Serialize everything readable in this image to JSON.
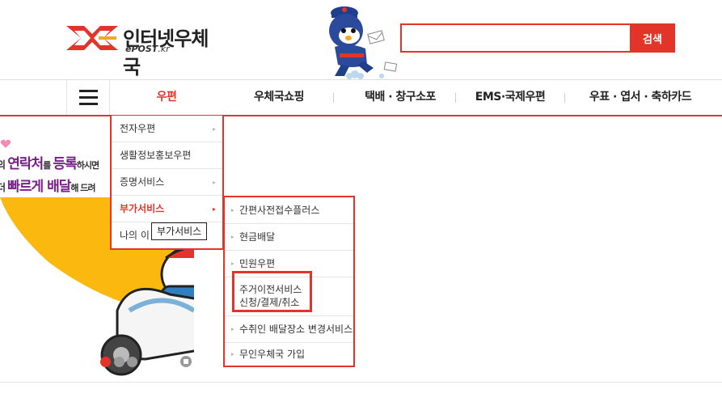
{
  "header": {
    "logo_text": "인터넷우체국",
    "logo_sub_bold": "ePOST",
    "logo_sub_rest": ".kr",
    "search": {
      "value": "",
      "placeholder": "",
      "button": "검색"
    }
  },
  "gnb": {
    "items": [
      {
        "label": "우편",
        "active": true
      },
      {
        "label": "우체국쇼핑"
      },
      {
        "label": "택배 · 창구소포"
      },
      {
        "label": "EMS·국제우편"
      },
      {
        "label": "우표 · 엽서 · 축하카드"
      }
    ]
  },
  "banner": {
    "line1_pre": "의",
    "line1_em": "연락처",
    "line1_mid": "를",
    "line1_em2": "등록",
    "line1_post": "하시면",
    "line2_pre": "더",
    "line2_em": "빠르게 배달",
    "line2_post": "해 드려",
    "colors": {
      "yellow": "#fbb90f",
      "red": "#e3342a",
      "purple": "#7a1f8a"
    }
  },
  "menu1": {
    "items": [
      {
        "label": "전자우편"
      },
      {
        "label": "생활정보홍보우편"
      },
      {
        "label": "증명서비스"
      },
      {
        "label": "부가서비스",
        "active": true
      },
      {
        "label": "나의 이"
      }
    ]
  },
  "tooltip": "부가서비스",
  "menu2": {
    "items": [
      {
        "label": "간편사전접수플러스"
      },
      {
        "label": "현금배달"
      },
      {
        "label": "민원우편"
      },
      {
        "label": "주거이전서비스",
        "label2": "신청/결제/취소",
        "highlight": true
      },
      {
        "label": "수취인 배달장소 변경서비스"
      },
      {
        "label": "무인우체국 가입"
      }
    ]
  }
}
